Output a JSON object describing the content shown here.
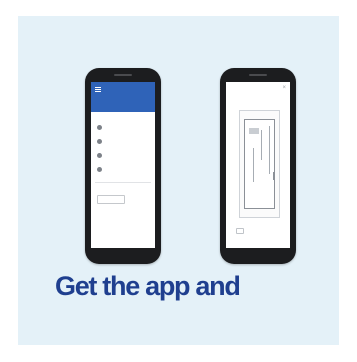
{
  "headline": "Get the app and",
  "colors": {
    "panel_background": "#e4f1f8",
    "headline": "#1f3f8f",
    "app_bar": "#2f63b8",
    "phone_body": "#1c1d1f"
  },
  "left_phone": {
    "menu_icons": [
      "deposit-icon",
      "transfer-icon",
      "bill-pay-icon",
      "alerts-icon"
    ]
  },
  "right_phone": {
    "close_icon": "×"
  }
}
